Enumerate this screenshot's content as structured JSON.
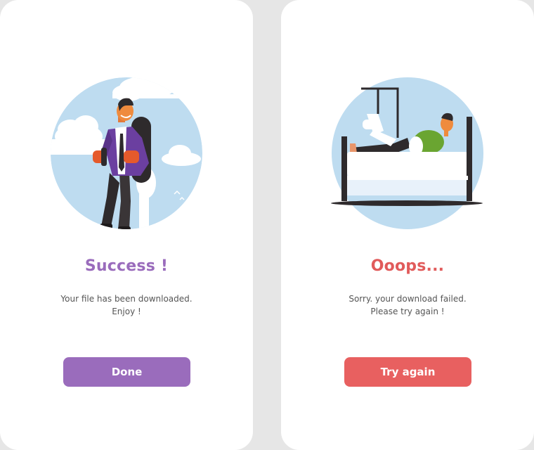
{
  "success_card": {
    "title": "Success !",
    "message_line1": "Your file has been downloaded.",
    "message_line2": "Enjoy !",
    "button_label": "Done",
    "accent_color": "#9a6cbc",
    "illustration": "man-with-jetpack-in-sky"
  },
  "failure_card": {
    "title": "Ooops...",
    "message_line1": "Sorry. your download failed.",
    "message_line2": "Please try again !",
    "button_label": "Try again",
    "accent_color": "#e86060",
    "illustration": "injured-man-in-hospital-bed"
  }
}
